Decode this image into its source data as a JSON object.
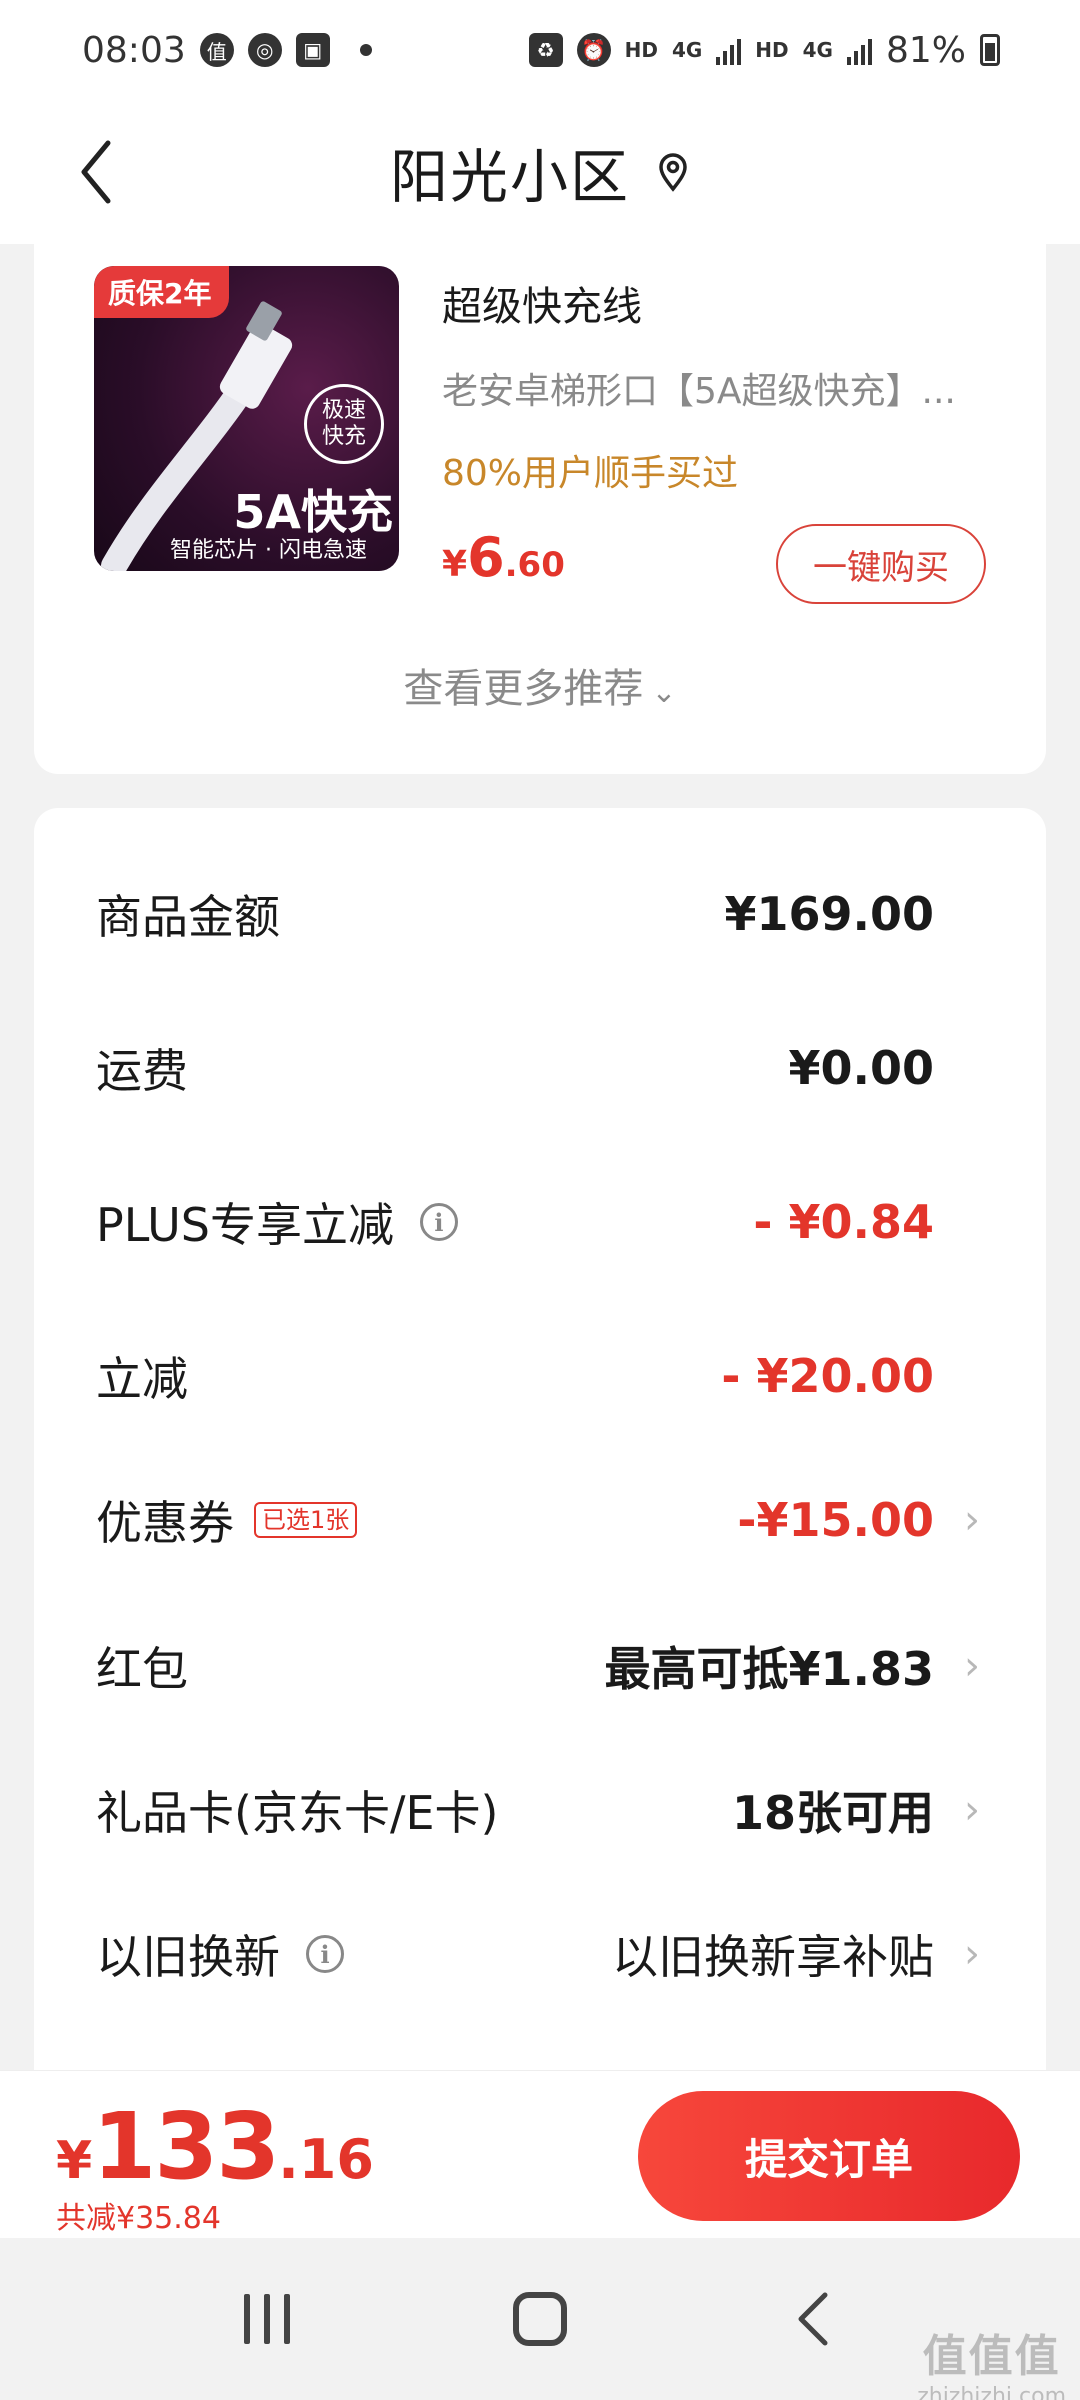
{
  "status_bar": {
    "time": "08:03",
    "icons_left": [
      "zhi-icon",
      "sync-icon",
      "image-icon",
      "dot-icon"
    ],
    "net1_hd": "HD",
    "net1_type": "4G",
    "net2_hd": "HD",
    "net2_type": "4G",
    "battery": "81%"
  },
  "header": {
    "title": "阳光小区"
  },
  "recommendation": {
    "image": {
      "warranty": "质保2年",
      "speed_badge": "极速快充",
      "fast_label": "5A快充",
      "chip_label": "智能芯片 · 闪电急速"
    },
    "name": "超级快充线",
    "subtitle": "老安卓梯形口【5A超级快充】...",
    "hint": "80%用户顺手买过",
    "price": {
      "currency": "¥",
      "integer": "6",
      "decimal": ".60"
    },
    "buy_label": "一键购买",
    "more_label": "查看更多推荐",
    "more_chevron": "⌄"
  },
  "summary": {
    "rows": [
      {
        "label": "商品金额",
        "value": "¥169.00"
      },
      {
        "label": "运费",
        "value": "¥0.00"
      },
      {
        "label": "PLUS专享立减",
        "value": "- ¥0.84",
        "info": "i"
      },
      {
        "label": "立减",
        "value": "- ¥20.00"
      },
      {
        "label": "优惠券",
        "tag": "已选1张",
        "value": "-¥15.00",
        "chevron": "›"
      },
      {
        "label": "红包",
        "value": "最高可抵¥1.83",
        "chevron": "›"
      },
      {
        "label": "礼品卡(京东卡/E卡)",
        "value": "18张可用",
        "chevron": "›"
      },
      {
        "label": "以旧换新",
        "value": "以旧换新享补贴",
        "info": "i",
        "chevron": "›"
      }
    ]
  },
  "bottom_bar": {
    "total": {
      "currency": "¥",
      "integer": "133",
      "decimal": ".16"
    },
    "saved": "共减¥35.84",
    "submit_label": "提交订单"
  },
  "watermark": {
    "main": "值值值",
    "sub": "zhizhizhi.com"
  },
  "colors": {
    "accent_red": "#e3352b",
    "hint_orange": "#c8872a",
    "background": "#f2f2f2"
  }
}
